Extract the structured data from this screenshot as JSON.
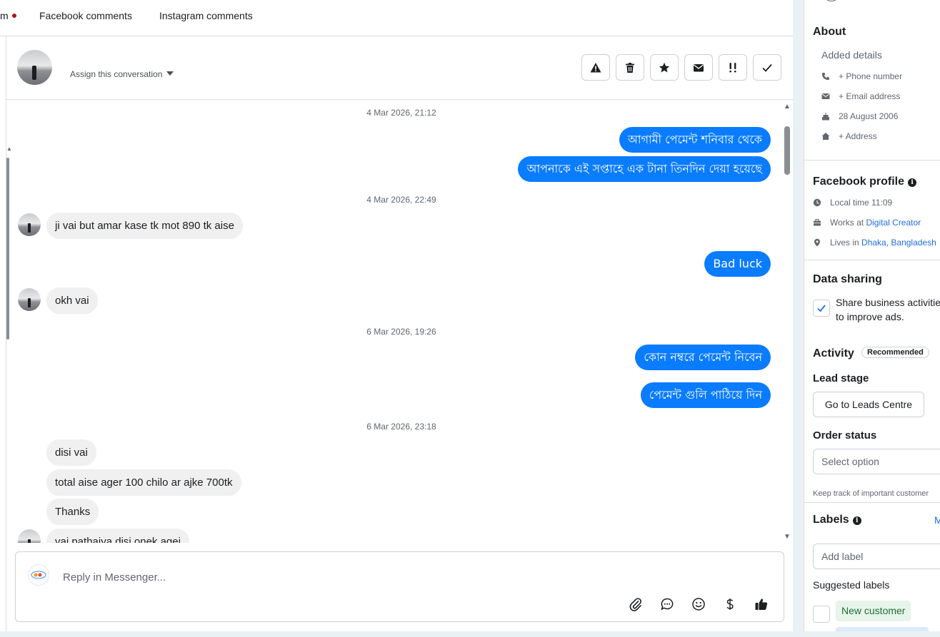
{
  "tabs": {
    "partial_first": "m",
    "facebook_comments": "Facebook comments",
    "instagram_comments": "Instagram comments"
  },
  "header": {
    "assign_label": "Assign this conversation",
    "actions": [
      "spam-icon",
      "trash-icon",
      "star-icon",
      "mail-icon",
      "priority-icon",
      "check-icon"
    ]
  },
  "messages": {
    "stamp1": "4 Mar 2026, 21:12",
    "out1": "আগামী পেমেন্ট শনিবার থেকে",
    "out2": "আপনাকে এই সপ্তাহে এক টানা তিনদিন দেয়া হয়েছে",
    "stamp2": "4 Mar 2026, 22:49",
    "in1": "ji vai but amar kase tk mot 890 tk aise",
    "out3": "Bad luck",
    "in2": "okh vai",
    "stamp3": "6 Mar 2026, 19:26",
    "out4": "কোন নম্বরে পেমেন্ট নিবেন",
    "out5": "পেমেন্ট গুলি পাঠিয়ে দিন",
    "stamp4": "6 Mar 2026, 23:18",
    "in3": "disi vai",
    "in4": "total aise ager 100 chilo ar ajke 700tk",
    "in5": "Thanks",
    "in6": "vai pathaiya disi onek agei"
  },
  "composer": {
    "placeholder": "Reply in Messenger...",
    "icons": [
      "attachment-icon",
      "chat-bubble-icon",
      "emoji-icon",
      "dollar-icon",
      "thumbs-up-icon"
    ]
  },
  "side": {
    "about": {
      "title": "About",
      "added_details": "Added details",
      "phone": "+ Phone number",
      "email": "+ Email address",
      "birthday": "28 August 2006",
      "address": "+ Address"
    },
    "facebook_profile": {
      "title": "Facebook profile",
      "local_time": "Local time 11:09",
      "works_prefix": "Works at ",
      "works_link": "Digital Creator",
      "lives_prefix": "Lives in ",
      "lives_link": "Dhaka, Bangladesh"
    },
    "data_sharing": {
      "title": "Data sharing",
      "checkbox_label": "Share business activities to improve ads.",
      "checked": true
    },
    "activity": {
      "title": "Activity",
      "badge": "Recommended",
      "lead_stage_title": "Lead stage",
      "leads_button": "Go to Leads Centre",
      "order_status_title": "Order status",
      "order_placeholder": "Select option",
      "order_hint": "Keep track of important customer"
    },
    "labels": {
      "title": "Labels",
      "manage_partial": "M",
      "add_placeholder": "Add label",
      "suggested_title": "Suggested labels",
      "suggested": [
        "New customer"
      ]
    }
  },
  "colors": {
    "accent": "#0a7cff",
    "link": "#216fdb",
    "unread_dot": "#b0121b",
    "chip_bg": "#e6f4ea"
  }
}
